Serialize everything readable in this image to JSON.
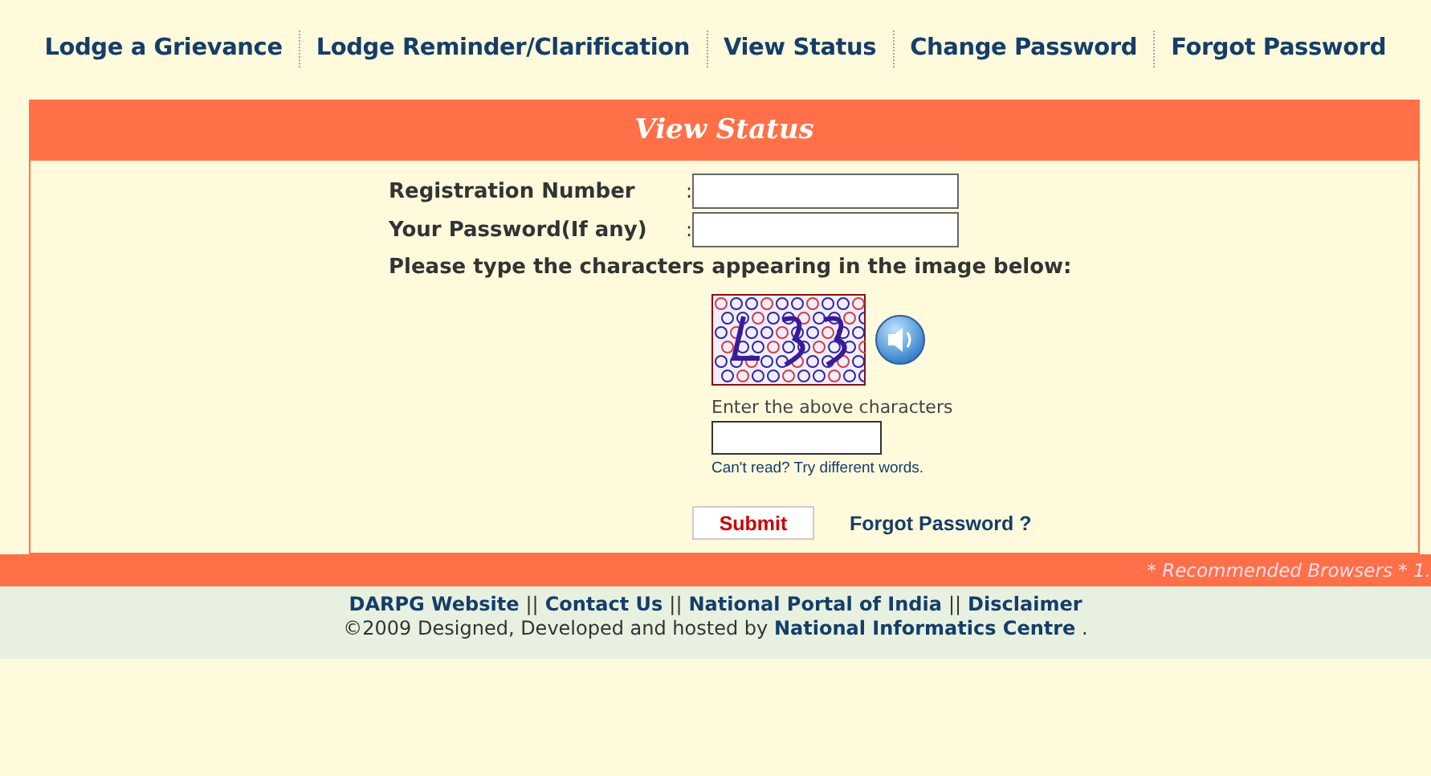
{
  "nav": [
    "Lodge a Grievance",
    "Lodge Reminder/Clarification",
    "View Status",
    "Change Password",
    "Forgot Password"
  ],
  "panel": {
    "title": "View Status",
    "fields": [
      {
        "label": "Registration Number",
        "separator": ":"
      },
      {
        "label": "Your Password(If any)",
        "separator": ":"
      }
    ],
    "captcha_prompt": "Please type the characters appearing in the image below:",
    "captcha": {
      "kind": "picture",
      "hint": "Enter the above characters",
      "refresh_link": "Can't read? Try different words."
    },
    "submit": "Submit",
    "forgot_link": "Forgot Password ?"
  },
  "notice": "* Recommended Browsers * 1.",
  "footer": {
    "links": [
      {
        "text": "DARPG Website"
      },
      {
        "text": "||",
        "kind": "separator"
      },
      {
        "text": "Contact Us"
      },
      {
        "text": "||",
        "kind": "separator"
      },
      {
        "text": "National Portal of India"
      },
      {
        "text": "||",
        "kind": "separator"
      },
      {
        "text": "Disclaimer"
      }
    ],
    "copyright": "©2009 Designed, Developed and hosted by",
    "credit_link": "National Informatics Centre",
    "end": "."
  }
}
